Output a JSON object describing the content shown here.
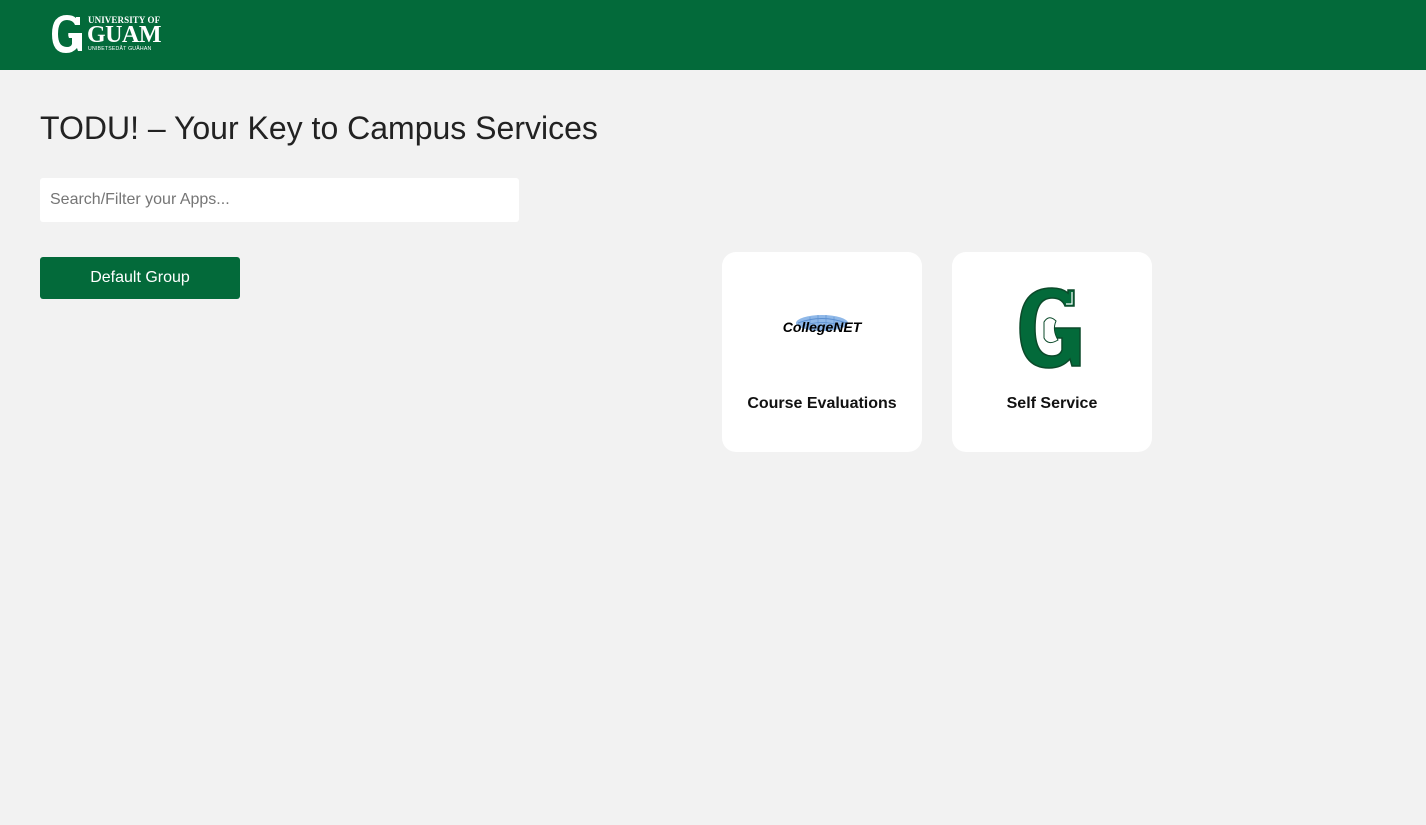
{
  "header": {
    "logo": {
      "line1": "UNIVERSITY OF",
      "line2": "GUAM",
      "line3": "UNIBETSEDÅT GUÅHAN",
      "icon": "g-monogram-icon"
    },
    "background_color": "#036a3a"
  },
  "main": {
    "title": "TODU! – Your Key to Campus Services",
    "search": {
      "placeholder": "Search/Filter your Apps...",
      "value": ""
    },
    "group_button": {
      "label": "Default Group"
    },
    "apps": [
      {
        "label": "Course Evaluations",
        "icon": "collegenet-logo-icon",
        "logo_text": "CollegeNET"
      },
      {
        "label": "Self Service",
        "icon": "g-monogram-icon"
      }
    ]
  },
  "colors": {
    "brand_green": "#036a3a",
    "page_background": "#f2f2f2",
    "tile_background": "#ffffff"
  }
}
